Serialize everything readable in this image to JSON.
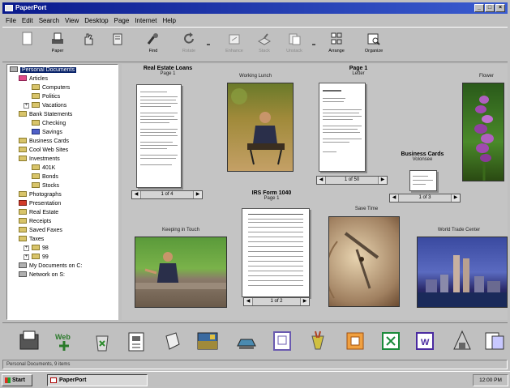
{
  "window": {
    "title": "PaperPort"
  },
  "menu": [
    "File",
    "Edit",
    "Search",
    "View",
    "Desktop",
    "Page",
    "Internet",
    "Help"
  ],
  "toolbar": [
    {
      "label": "",
      "icon": "new-page-icon",
      "enabled": false
    },
    {
      "label": "Paper",
      "icon": "scanner-icon",
      "enabled": true
    },
    {
      "label": "",
      "icon": "hand-icon",
      "enabled": false
    },
    {
      "label": "",
      "icon": "cut-icon",
      "enabled": false
    },
    {
      "label": "Find",
      "icon": "find-icon",
      "enabled": true
    },
    {
      "label": "Rotate",
      "icon": "rotate-icon",
      "enabled": false
    },
    {
      "label": "Enhance",
      "icon": "enhance-icon",
      "enabled": false
    },
    {
      "label": "Stack",
      "icon": "stack-icon",
      "enabled": false
    },
    {
      "label": "Unstack",
      "icon": "unstack-icon",
      "enabled": false
    },
    {
      "label": "Arrange",
      "icon": "arrange-icon",
      "enabled": true
    },
    {
      "label": "Organize",
      "icon": "organize-icon",
      "enabled": true
    }
  ],
  "tree": [
    {
      "label": "Personal Documents",
      "level": 0,
      "selected": true,
      "icon": "computer"
    },
    {
      "label": "Articles",
      "level": 1,
      "icon": "pink"
    },
    {
      "label": "Computers",
      "level": 2
    },
    {
      "label": "Politics",
      "level": 2
    },
    {
      "label": "Vacations",
      "level": 2,
      "expander": "+"
    },
    {
      "label": "Bank Statements",
      "level": 1
    },
    {
      "label": "Checking",
      "level": 2
    },
    {
      "label": "Savings",
      "level": 2,
      "icon": "blue"
    },
    {
      "label": "Business Cards",
      "level": 1
    },
    {
      "label": "Cool Web Sites",
      "level": 1
    },
    {
      "label": "Investments",
      "level": 1
    },
    {
      "label": "401K",
      "level": 2
    },
    {
      "label": "Bonds",
      "level": 2
    },
    {
      "label": "Stocks",
      "level": 2
    },
    {
      "label": "Photographs",
      "level": 1
    },
    {
      "label": "Presentation",
      "level": 1,
      "icon": "red"
    },
    {
      "label": "Real Estate",
      "level": 1
    },
    {
      "label": "Receipts",
      "level": 1
    },
    {
      "label": "Saved Faxes",
      "level": 1
    },
    {
      "label": "Taxes",
      "level": 1
    },
    {
      "label": "98",
      "level": 2,
      "expander": "+"
    },
    {
      "label": "99",
      "level": 2,
      "expander": "+"
    },
    {
      "label": "My Documents on C:",
      "level": 0,
      "icon": "pc"
    },
    {
      "label": "Network on S:",
      "level": 0,
      "icon": "pc"
    }
  ],
  "documents": {
    "real_estate": {
      "title": "Real Estate Loans",
      "subtitle": "Page 1",
      "pager": "1 of 4"
    },
    "working_lunch": {
      "title": "Working Lunch"
    },
    "letter": {
      "title": "Page 1",
      "subtitle": "Letter",
      "pager": "1 of 50"
    },
    "flower": {
      "title": "Flower"
    },
    "business_cards": {
      "title": "Business Cards",
      "subtitle": "Volonsee",
      "pager": "1 of 3"
    },
    "irs_form": {
      "title": "IRS Form 1040",
      "subtitle": "Page 1",
      "pager": "1 of 2"
    },
    "keeping": {
      "title": "Keeping in Touch"
    },
    "save_time": {
      "title": "Save Time"
    },
    "wtc": {
      "title": "World Trade Center"
    }
  },
  "sendto": [
    "fax-icon",
    "web-icon",
    "recycle-icon",
    "printer-icon",
    "globe-icon",
    "photo-editor-icon",
    "scanner-icon",
    "copy-icon",
    "paint-icon",
    "presentation-icon",
    "spreadsheet-icon",
    "word-icon",
    "ocr-icon",
    "mail-icon"
  ],
  "status": {
    "text": "Personal Documents, 9 items"
  },
  "taskbar": {
    "start": "Start",
    "app": "PaperPort",
    "clock": "12:00 PM"
  },
  "colors": {
    "titlebar": "#0a1a8c",
    "selection": "#0a246a",
    "folder": "#d8c46a"
  }
}
